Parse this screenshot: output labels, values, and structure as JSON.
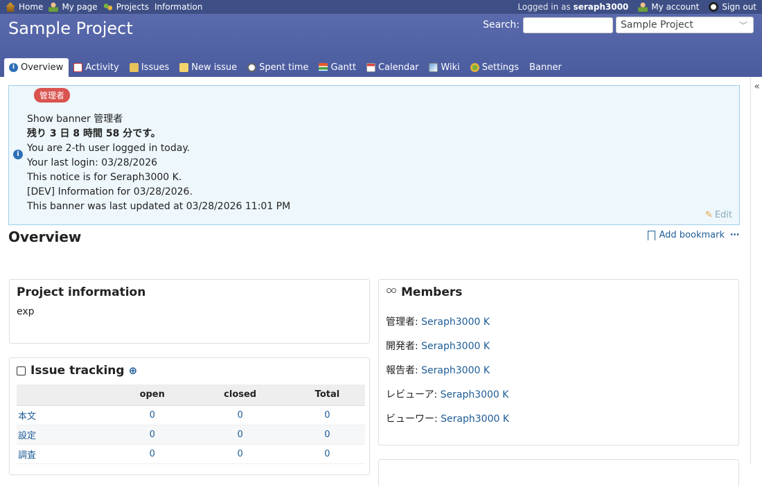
{
  "top_menu": {
    "items": [
      "Home",
      "My page",
      "Projects",
      "Information"
    ],
    "logged_in_prefix": "Logged in as",
    "username": "seraph3000",
    "my_account": "My account",
    "sign_out": "Sign out"
  },
  "header": {
    "project_title": "Sample Project",
    "search_label": "Search:",
    "search_value": "",
    "project_jump": "Sample Project"
  },
  "tabs": [
    {
      "label": "Overview",
      "selected": true
    },
    {
      "label": "Activity"
    },
    {
      "label": "Issues"
    },
    {
      "label": "New issue"
    },
    {
      "label": "Spent time"
    },
    {
      "label": "Gantt"
    },
    {
      "label": "Calendar"
    },
    {
      "label": "Wiki"
    },
    {
      "label": "Settings"
    },
    {
      "label": "Banner"
    }
  ],
  "sidebar_toggle": "«",
  "banner": {
    "role_badge": "管理者",
    "lines": [
      "Show banner 管理者",
      "残り 3 日 8 時間 58 分です。",
      "You are 2-th user logged in today.",
      "Your last login: 03/28/2026",
      "This notice is for Seraph3000 K.",
      "[DEV] Information for 03/28/2026.",
      "This banner was last updated at 03/28/2026 11:01 PM"
    ],
    "edit": "Edit"
  },
  "page_title": "Overview",
  "bookmark": {
    "label": "Add bookmark",
    "more": "⋯"
  },
  "project_info": {
    "title": "Project information",
    "description": "exp"
  },
  "issue_tracking": {
    "title": "Issue tracking",
    "columns": [
      "",
      "open",
      "closed",
      "Total"
    ],
    "rows": [
      {
        "name": "本文",
        "open": "0",
        "closed": "0",
        "total": "0"
      },
      {
        "name": "設定",
        "open": "0",
        "closed": "0",
        "total": "0"
      },
      {
        "name": "調査",
        "open": "0",
        "closed": "0",
        "total": "0"
      }
    ]
  },
  "members": {
    "title": "Members",
    "rows": [
      {
        "role": "管理者: ",
        "name": "Seraph3000 K"
      },
      {
        "role": "開発者: ",
        "name": "Seraph3000 K"
      },
      {
        "role": "報告者: ",
        "name": "Seraph3000 K"
      },
      {
        "role": "レビューア: ",
        "name": "Seraph3000 K"
      },
      {
        "role": "ビューワー: ",
        "name": "Seraph3000 K"
      }
    ]
  }
}
